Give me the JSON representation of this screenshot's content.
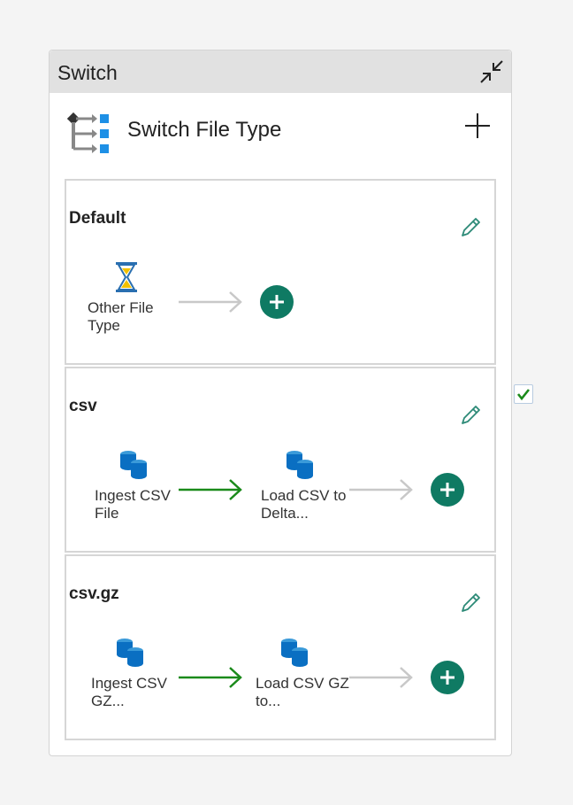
{
  "panel": {
    "title": "Switch",
    "activity_name": "Switch File Type"
  },
  "cases": [
    {
      "name": "Default",
      "nodes": [
        {
          "label": "Other File Type",
          "icon": "hourglass-wait-icon"
        }
      ]
    },
    {
      "name": "csv",
      "nodes": [
        {
          "label": "Ingest CSV File",
          "icon": "copy-data-icon"
        },
        {
          "label": "Load CSV to Delta...",
          "icon": "copy-data-icon"
        }
      ]
    },
    {
      "name": "csv.gz",
      "nodes": [
        {
          "label": "Ingest CSV GZ...",
          "icon": "copy-data-icon"
        },
        {
          "label": "Load CSV GZ to...",
          "icon": "copy-data-icon"
        }
      ]
    }
  ],
  "checkbox": {
    "checked": true
  },
  "colors": {
    "accent_green": "#0f7a63",
    "success_arrow": "#1a8a1a",
    "pending_arrow": "#c8c8c8",
    "header_bg": "#e1e1e1",
    "db_blue": "#0a6fc2"
  }
}
